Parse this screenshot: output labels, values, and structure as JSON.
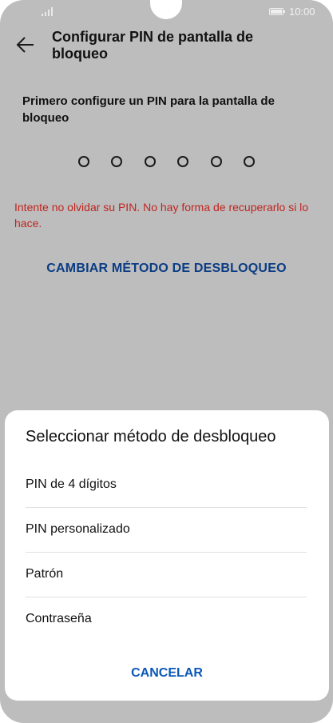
{
  "status_bar": {
    "time": "10:00"
  },
  "header": {
    "title": "Configurar PIN de pantalla de bloqueo"
  },
  "main": {
    "instruction": "Primero configure un PIN para la pantalla de bloqueo",
    "pin_length": 6,
    "warning": "Intente no olvidar su PIN. No hay forma de recuperarlo si lo hace.",
    "change_method": "CAMBIAR MÉTODO DE DESBLOQUEO"
  },
  "sheet": {
    "title": "Seleccionar método de desbloqueo",
    "options": [
      {
        "label": "PIN de 4 dígitos"
      },
      {
        "label": "PIN personalizado"
      },
      {
        "label": "Patrón"
      },
      {
        "label": "Contraseña"
      }
    ],
    "cancel": "CANCELAR"
  }
}
